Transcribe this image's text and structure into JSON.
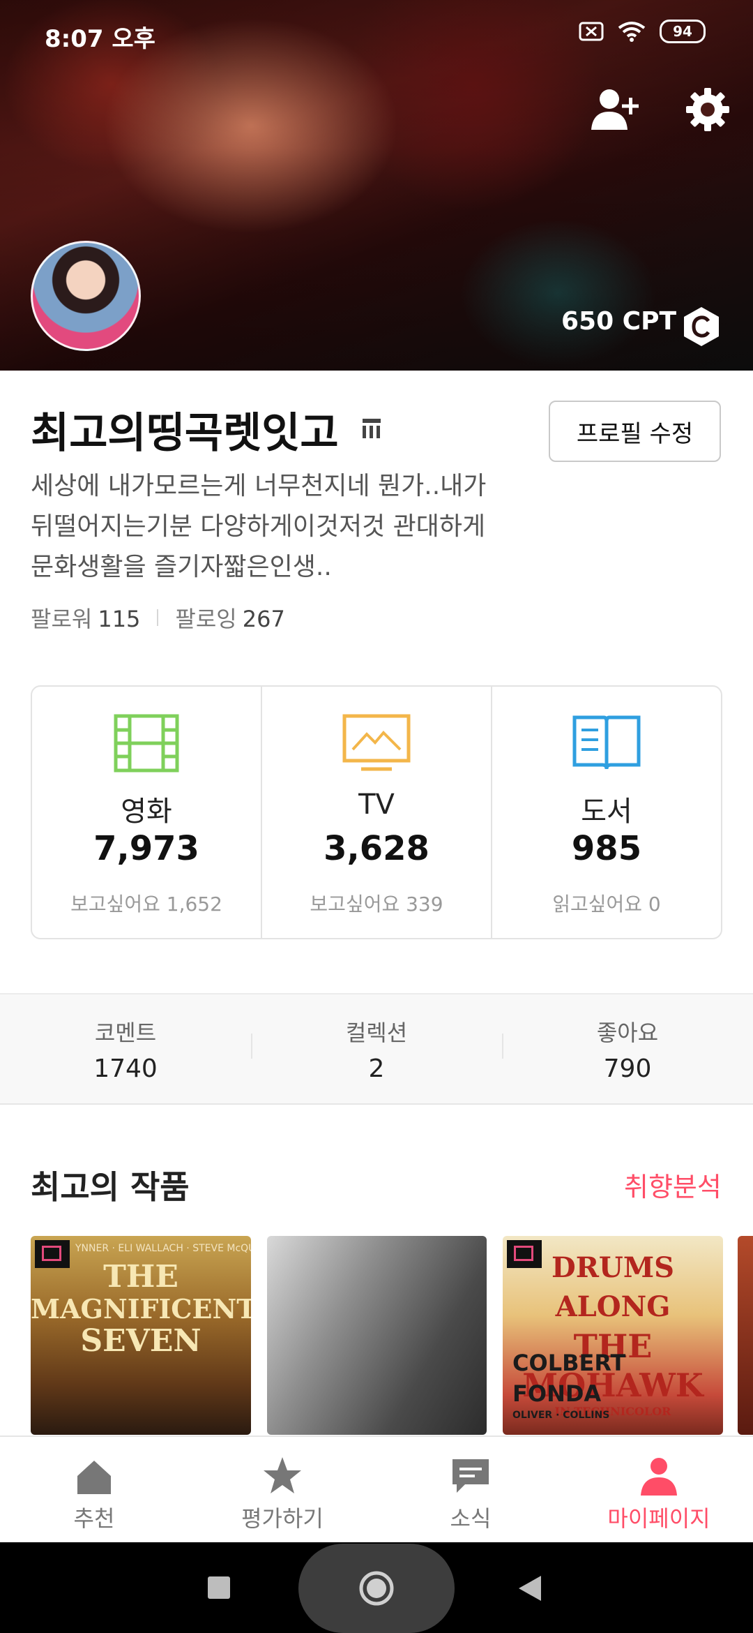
{
  "status_bar": {
    "time": "8:07 오후",
    "battery": "94"
  },
  "header": {
    "cpt": "650 CPT"
  },
  "profile": {
    "name": "최고의띵곡렛잇고",
    "edit_button": "프로필 수정",
    "bio_lines": [
      "세상에 내가모르는게 너무천지네 뭔가..내가",
      "뒤떨어지는기분 다양하게이것저것 관대하게",
      "문화생활을 즐기자짧은인생.."
    ],
    "followers_label": "팔로워",
    "followers_count": "115",
    "following_label": "팔로잉",
    "following_count": "267"
  },
  "categories": [
    {
      "icon": "film-icon",
      "label": "영화",
      "count": "7,973",
      "sub": "보고싶어요 1,652",
      "color": "#7fd05b"
    },
    {
      "icon": "tv-icon",
      "label": "TV",
      "count": "3,628",
      "sub": "보고싶어요 339",
      "color": "#f3b64a"
    },
    {
      "icon": "book-icon",
      "label": "도서",
      "count": "985",
      "sub": "읽고싶어요 0",
      "color": "#2f9fe0"
    }
  ],
  "stats": [
    {
      "label": "코멘트",
      "value": "1740"
    },
    {
      "label": "컬렉션",
      "value": "2"
    },
    {
      "label": "좋아요",
      "value": "790"
    }
  ],
  "best_works": {
    "title": "최고의 작품",
    "link": "취향분석",
    "posters": [
      {
        "top_credit": "YNNER · ELI WALLACH · STEVE McQUEEN",
        "title_lines": [
          "THE",
          "MAGNIFICENT",
          "SEVEN"
        ]
      },
      {},
      {
        "title_lines": [
          "DRUMS ALONG",
          "THE MOHAWK"
        ],
        "sub": "IN TECHNICOLOR",
        "names": [
          "COLBERT",
          "FONDA"
        ],
        "credit": "OLIVER · COLLINS"
      }
    ]
  },
  "bottom_nav": [
    {
      "label": "추천",
      "icon": "home-icon"
    },
    {
      "label": "평가하기",
      "icon": "star-icon"
    },
    {
      "label": "소식",
      "icon": "chat-icon"
    },
    {
      "label": "마이페이지",
      "icon": "person-icon",
      "active": true
    }
  ],
  "colors": {
    "accent": "#ff4d67"
  }
}
